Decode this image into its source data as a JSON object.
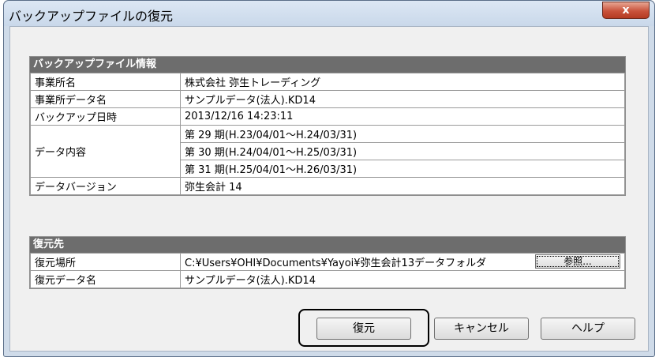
{
  "window": {
    "title": "バックアップファイルの復元",
    "close_label": "x"
  },
  "backup_info": {
    "header": "バックアップファイル情報",
    "rows": [
      {
        "label": "事業所名",
        "value": "株式会社 弥生トレーディング"
      },
      {
        "label": "事業所データ名",
        "value": "サンプルデータ(法人).KD14"
      },
      {
        "label": "バックアップ日時",
        "value": "2013/12/16 14:23:11"
      }
    ],
    "data_content_label": "データ内容",
    "periods": [
      "第 29 期(H.23/04/01～H.24/03/31)",
      "第 30 期(H.24/04/01～H.25/03/31)",
      "第 31 期(H.25/04/01～H.26/03/31)"
    ],
    "version_label": "データバージョン",
    "version_value": "弥生会計 14"
  },
  "restore_dest": {
    "header": "復元先",
    "location_label": "復元場所",
    "location_value": "C:¥Users¥OHI¥Documents¥Yayoi¥弥生会計13データフォルダ",
    "browse_label": "参照...",
    "name_label": "復元データ名",
    "name_value": "サンプルデータ(法人).KD14"
  },
  "buttons": {
    "restore": "復元",
    "cancel": "キャンセル",
    "help": "ヘルプ"
  },
  "colors": {
    "header_bg": "#6d6d6d",
    "close_button": "#c9523b",
    "window_frame": "#cfdbe9"
  }
}
